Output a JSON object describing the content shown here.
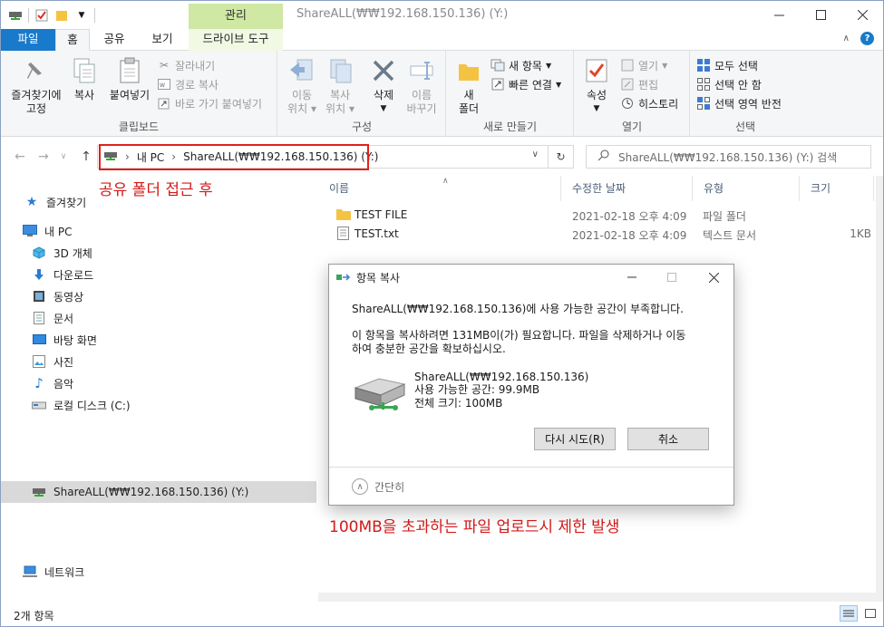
{
  "titlebar": {
    "contextual_tab": "관리",
    "title": "ShareALL(₩₩192.168.150.136) (Y:)"
  },
  "tabs": {
    "file": "파일",
    "home": "홈",
    "share": "공유",
    "view": "보기",
    "drive_tools": "드라이브 도구"
  },
  "ribbon": {
    "clipboard": {
      "label": "클립보드",
      "pin": [
        "즐겨찾기에",
        "고정"
      ],
      "copy": "복사",
      "paste": "붙여넣기",
      "cut": "잘라내기",
      "copy_path": "경로 복사",
      "paste_shortcut": "바로 가기 붙여넣기"
    },
    "organize": {
      "label": "구성",
      "move_to": [
        "이동",
        "위치"
      ],
      "copy_to": [
        "복사",
        "위치"
      ],
      "delete": "삭제",
      "rename": [
        "이름",
        "바꾸기"
      ]
    },
    "new": {
      "label": "새로 만들기",
      "new_folder": [
        "새",
        "폴더"
      ],
      "new_item": "새 항목",
      "easy_access": "빠른 연결"
    },
    "open": {
      "label": "열기",
      "properties": "속성",
      "open": "열기",
      "edit": "편집",
      "history": "히스토리"
    },
    "select": {
      "label": "선택",
      "select_all": "모두 선택",
      "select_none": "선택 안 함",
      "invert": "선택 영역 반전"
    }
  },
  "address": {
    "crumbs": [
      "내 PC",
      "ShareALL(₩₩192.168.150.136) (Y:)"
    ],
    "search_placeholder": "ShareALL(₩₩192.168.150.136) (Y:) 검색"
  },
  "annotations": {
    "top": "공유 폴더 접근 후",
    "bottom": "100MB을 초과하는 파일 업로드시 제한 발생"
  },
  "sidebar": {
    "quick_access": "즐겨찾기",
    "this_pc": "내 PC",
    "items": [
      "3D 개체",
      "다운로드",
      "동영상",
      "문서",
      "바탕 화면",
      "사진",
      "음악",
      "로컬 디스크 (C:)"
    ],
    "share_drive": "ShareALL(₩₩192.168.150.136) (Y:)",
    "network": "네트워크"
  },
  "columns": {
    "name": "이름",
    "modified": "수정한 날짜",
    "type": "유형",
    "size": "크기"
  },
  "files": [
    {
      "name": "TEST FILE",
      "modified": "2021-02-18 오후 4:09",
      "type": "파일 폴더",
      "size": ""
    },
    {
      "name": "TEST.txt",
      "modified": "2021-02-18 오후 4:09",
      "type": "텍스트 문서",
      "size": "1KB"
    }
  ],
  "status": {
    "count": "2개 항목"
  },
  "dialog": {
    "title": "항목 복사",
    "message1": "ShareALL(₩₩192.168.150.136)에 사용 가능한 공간이 부족합니다.",
    "message2_line1": "이 항목을 복사하려면 131MB이(가) 필요합니다. 파일을 삭제하거나 이동",
    "message2_line2": "하여 충분한 공간을 확보하십시오.",
    "drive_name": "ShareALL(₩₩192.168.150.136)",
    "free_space": "사용 가능한 공간: 99.9MB",
    "total_size": "전체 크기: 100MB",
    "retry": "다시 시도(R)",
    "cancel": "취소",
    "fewer_details": "간단히"
  },
  "colors": {
    "file_tab": "#1979ca",
    "manage_tab": "#cfe8a4",
    "annotation": "#d41a1a",
    "folder": "#f5c342"
  }
}
